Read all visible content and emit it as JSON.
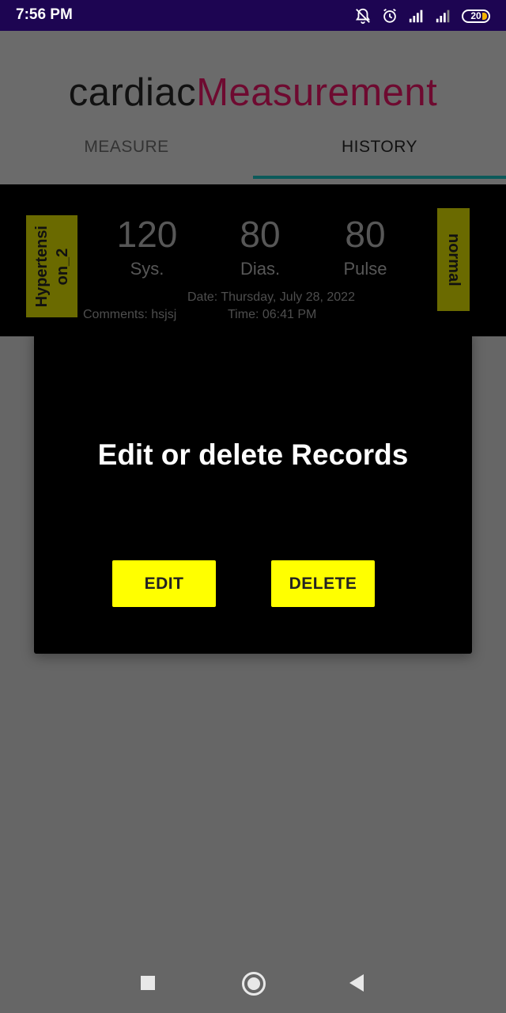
{
  "status_bar": {
    "time": "7:56 PM",
    "battery_level": "20",
    "icons": [
      "mute-icon",
      "alarm-icon",
      "signal-icon",
      "signal-icon",
      "battery-icon"
    ]
  },
  "app": {
    "title_part1": "cardiac",
    "title_part2": "Measurement",
    "tabs": [
      {
        "label": "MEASURE",
        "selected": false
      },
      {
        "label": "HISTORY",
        "selected": true
      }
    ]
  },
  "record": {
    "category_tag": "Hypertension_2",
    "category_tag_lines": [
      "Hypertensi",
      "on_2"
    ],
    "status_tag": "normal",
    "systolic": "120",
    "systolic_label": "Sys.",
    "diastolic": "80",
    "diastolic_label": "Dias.",
    "pulse": "80",
    "pulse_label": "Pulse",
    "date": "Date: Thursday, July 28, 2022",
    "comments": "Comments: hsjsj",
    "time": "Time: 06:41 PM"
  },
  "dialog": {
    "title": "Edit or delete Records",
    "edit_label": "EDIT",
    "delete_label": "DELETE"
  },
  "colors": {
    "status_bar": "#1d0552",
    "accent_title": "#6e0a30",
    "tab_indicator": "#0c5a5a",
    "button": "#ffff00",
    "tag": "#6a6a00"
  }
}
